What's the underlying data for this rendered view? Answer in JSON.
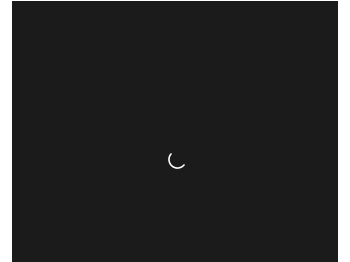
{
  "viewport": {
    "state": "loading",
    "background_color": "#1b1b1b"
  },
  "spinner": {
    "icon": "loading-spinner-icon",
    "color": "#ffffff"
  }
}
